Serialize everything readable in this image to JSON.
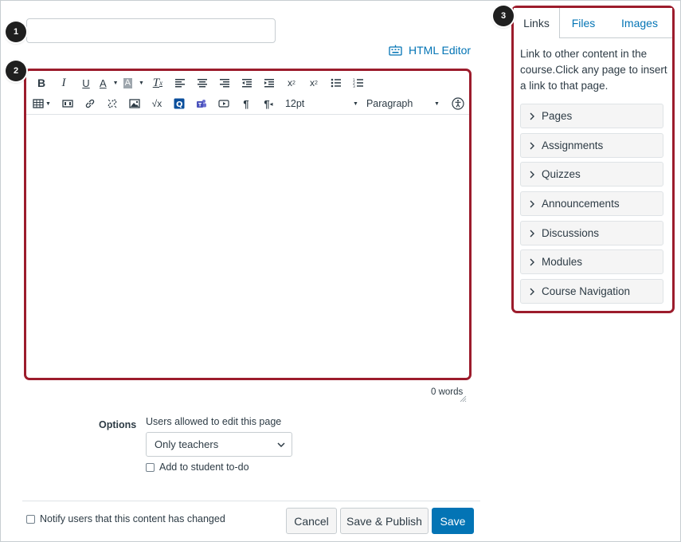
{
  "badges": [
    "1",
    "2",
    "3"
  ],
  "title_input": {
    "value": "",
    "placeholder": ""
  },
  "html_editor": {
    "label": "HTML Editor",
    "icon": "keyboard-icon"
  },
  "toolbar": {
    "font_size": "12pt",
    "block_format": "Paragraph"
  },
  "word_count": "0 words",
  "options": {
    "label": "Options",
    "help": "Users allowed to edit this page",
    "selected": "Only teachers",
    "add_todo": "Add to student to-do"
  },
  "notify": "Notify users that this content has changed",
  "buttons": {
    "cancel": "Cancel",
    "save_publish": "Save & Publish",
    "save": "Save"
  },
  "sidebar": {
    "tabs": [
      "Links",
      "Files",
      "Images"
    ],
    "description": "Link to other content in the course.Click any page to insert a link to that page.",
    "items": [
      "Pages",
      "Assignments",
      "Quizzes",
      "Announcements",
      "Discussions",
      "Modules",
      "Course Navigation"
    ]
  },
  "colors": {
    "accent": "#0374b5",
    "highlight_border": "#9c1c2c"
  }
}
